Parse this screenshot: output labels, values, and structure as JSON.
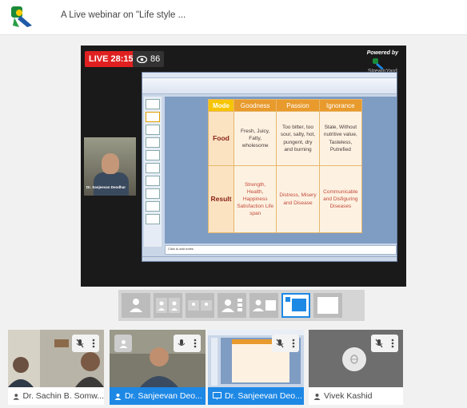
{
  "header": {
    "title": "A Live webinar on \"Life style ..."
  },
  "stage": {
    "live_label": "LIVE 28:15",
    "viewer_count": "86",
    "powered_by": "Powered by",
    "brand": "StreamYard"
  },
  "pip": {
    "name": "Dr. Sanjeevan Deodhar"
  },
  "slide": {
    "headers": [
      "Mode",
      "Goodness",
      "Passion",
      "Ignorance"
    ],
    "rows": [
      {
        "label": "Food",
        "cells": [
          "Fresh, Juicy, Fatty, wholesome",
          "Too bitter, too sour, salty, hot, pungent, dry and burning",
          "Stale, Without nutritive value, Tasteless, Putrefied"
        ]
      },
      {
        "label": "Result",
        "cells": [
          "Strength, Health, Happiness Satisfaction Life span",
          "Distress, Misery and Disease",
          "Communicable and Disfiguring Diseases"
        ]
      }
    ],
    "notes_placeholder": "Click to add notes"
  },
  "participants": [
    {
      "name": "Dr. Sachin B. Somw...",
      "icon": "person-icon"
    },
    {
      "name": "Dr. Sanjeevan Deo...",
      "icon": "person-icon"
    },
    {
      "name": "Dr. Sanjeevan Deo...",
      "icon": "screen-share-icon"
    },
    {
      "name": "Vivek Kashid",
      "icon": "person-icon"
    }
  ],
  "colors": {
    "live_red": "#e02020",
    "accent_blue": "#1e88e5",
    "slide_header_orange": "#e89a2c",
    "slide_mode_yellow": "#f7c500"
  }
}
